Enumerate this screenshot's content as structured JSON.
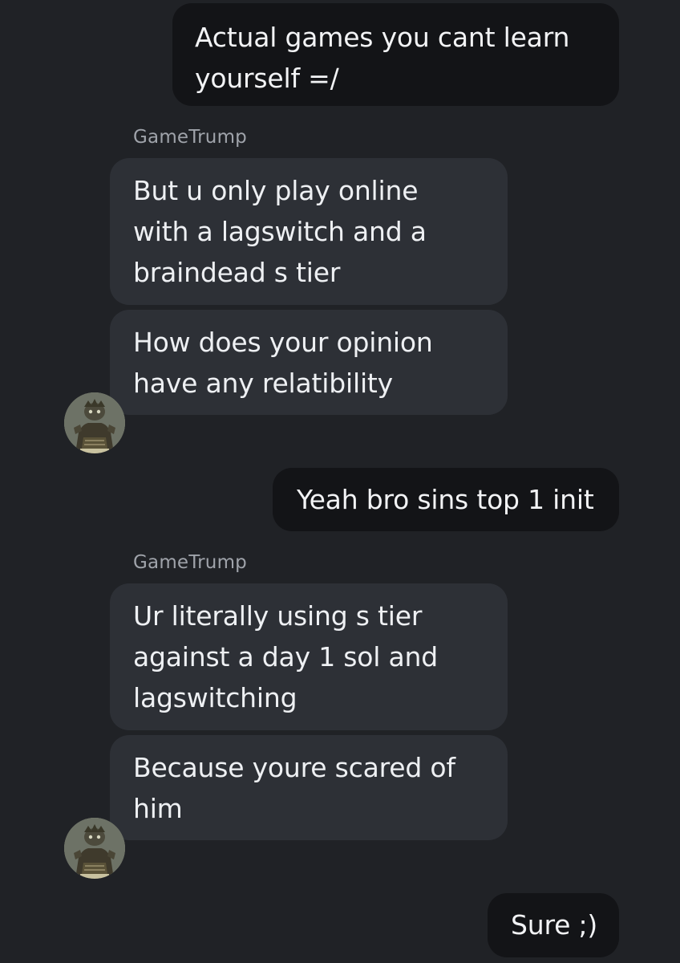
{
  "conversation": {
    "messages": [
      {
        "direction": "sent",
        "text": "Actual games you cant learn\nyourself =/"
      },
      {
        "direction": "received",
        "sender": "GameTrump",
        "text": "But u only play online\nwith a lagswitch and a\nbraindead s tier"
      },
      {
        "direction": "received",
        "text": "How does your opinion\nhave any relatibility"
      },
      {
        "direction": "sent",
        "text": "Yeah bro sins top 1 init"
      },
      {
        "direction": "received",
        "sender": "GameTrump",
        "text": "Ur literally using s tier\nagainst a day 1 sol and\nlagswitching"
      },
      {
        "direction": "received",
        "text": "Because youre scared of\nhim"
      },
      {
        "direction": "sent",
        "text": "Sure ;)"
      }
    ]
  },
  "avatar_icon": "robed-figure-avatar"
}
